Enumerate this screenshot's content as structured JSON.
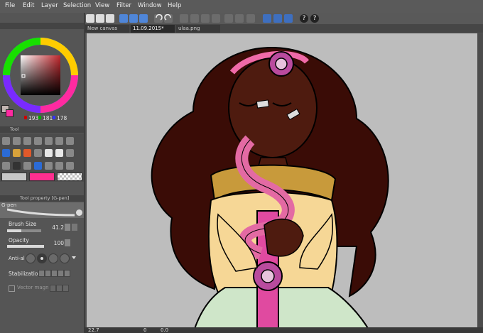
{
  "menubar": {
    "items": [
      "File",
      "Edit",
      "Layer",
      "Selection",
      "View",
      "Filter",
      "Window",
      "Help"
    ]
  },
  "tabs": [
    {
      "label": "New canvas",
      "active": false
    },
    {
      "label": "11.09.2015*",
      "active": true
    },
    {
      "label": "ulaa.png",
      "active": false
    }
  ],
  "color_panel": {
    "r": "193",
    "g": "181",
    "b": "178",
    "main_color": "#c1b5b2",
    "sub_color": "#ff2aa0"
  },
  "tool_panel": {
    "title": "Tool",
    "main_color": "#c7c7c7",
    "sub_color": "#ff2f8f"
  },
  "tool_property": {
    "title": "Tool property [G-pen]",
    "brush_name": "G-pen",
    "brush_size_label": "Brush Size",
    "brush_size_value": "41.2",
    "brush_size_level": 0.41,
    "opacity_label": "Opacity",
    "opacity_value": "100",
    "opacity_level": 1.0,
    "antialias_label": "Anti-al",
    "stabilization_label": "Stabilization",
    "vector_label": "Vector magn"
  },
  "statusbar": {
    "zoom": "22.7",
    "angle": "0",
    "rotation": "0.0"
  }
}
